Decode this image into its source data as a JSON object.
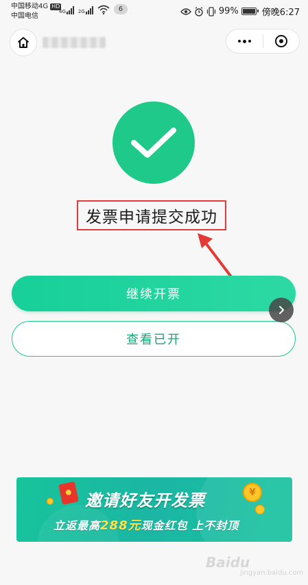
{
  "status_bar": {
    "carrier1": "中国移动4G",
    "hd": "HD",
    "carrier2": "中国电信",
    "net1": "4G",
    "net2": "2G",
    "notification_count": "6",
    "battery": "99%",
    "time": "傍晚6:27"
  },
  "nav": {
    "home_icon": "home-icon",
    "more_icon": "more-dots-icon",
    "close_icon": "target-close-icon"
  },
  "result": {
    "status_icon": "checkmark-icon",
    "message": "发票申请提交成功",
    "success_color": "#1ec98a",
    "highlight_color": "#e33b3b"
  },
  "actions": {
    "continue_label": "继续开票",
    "view_label": "查看已开"
  },
  "banner": {
    "title": "邀请好友开发票",
    "sub_prefix": "立返最高",
    "sub_amount": "288元",
    "sub_suffix": "现金红包 上不封顶",
    "coin_symbol": "¥"
  },
  "watermark": {
    "text": "Baidu",
    "sub": "jingyan.baidu.com"
  }
}
